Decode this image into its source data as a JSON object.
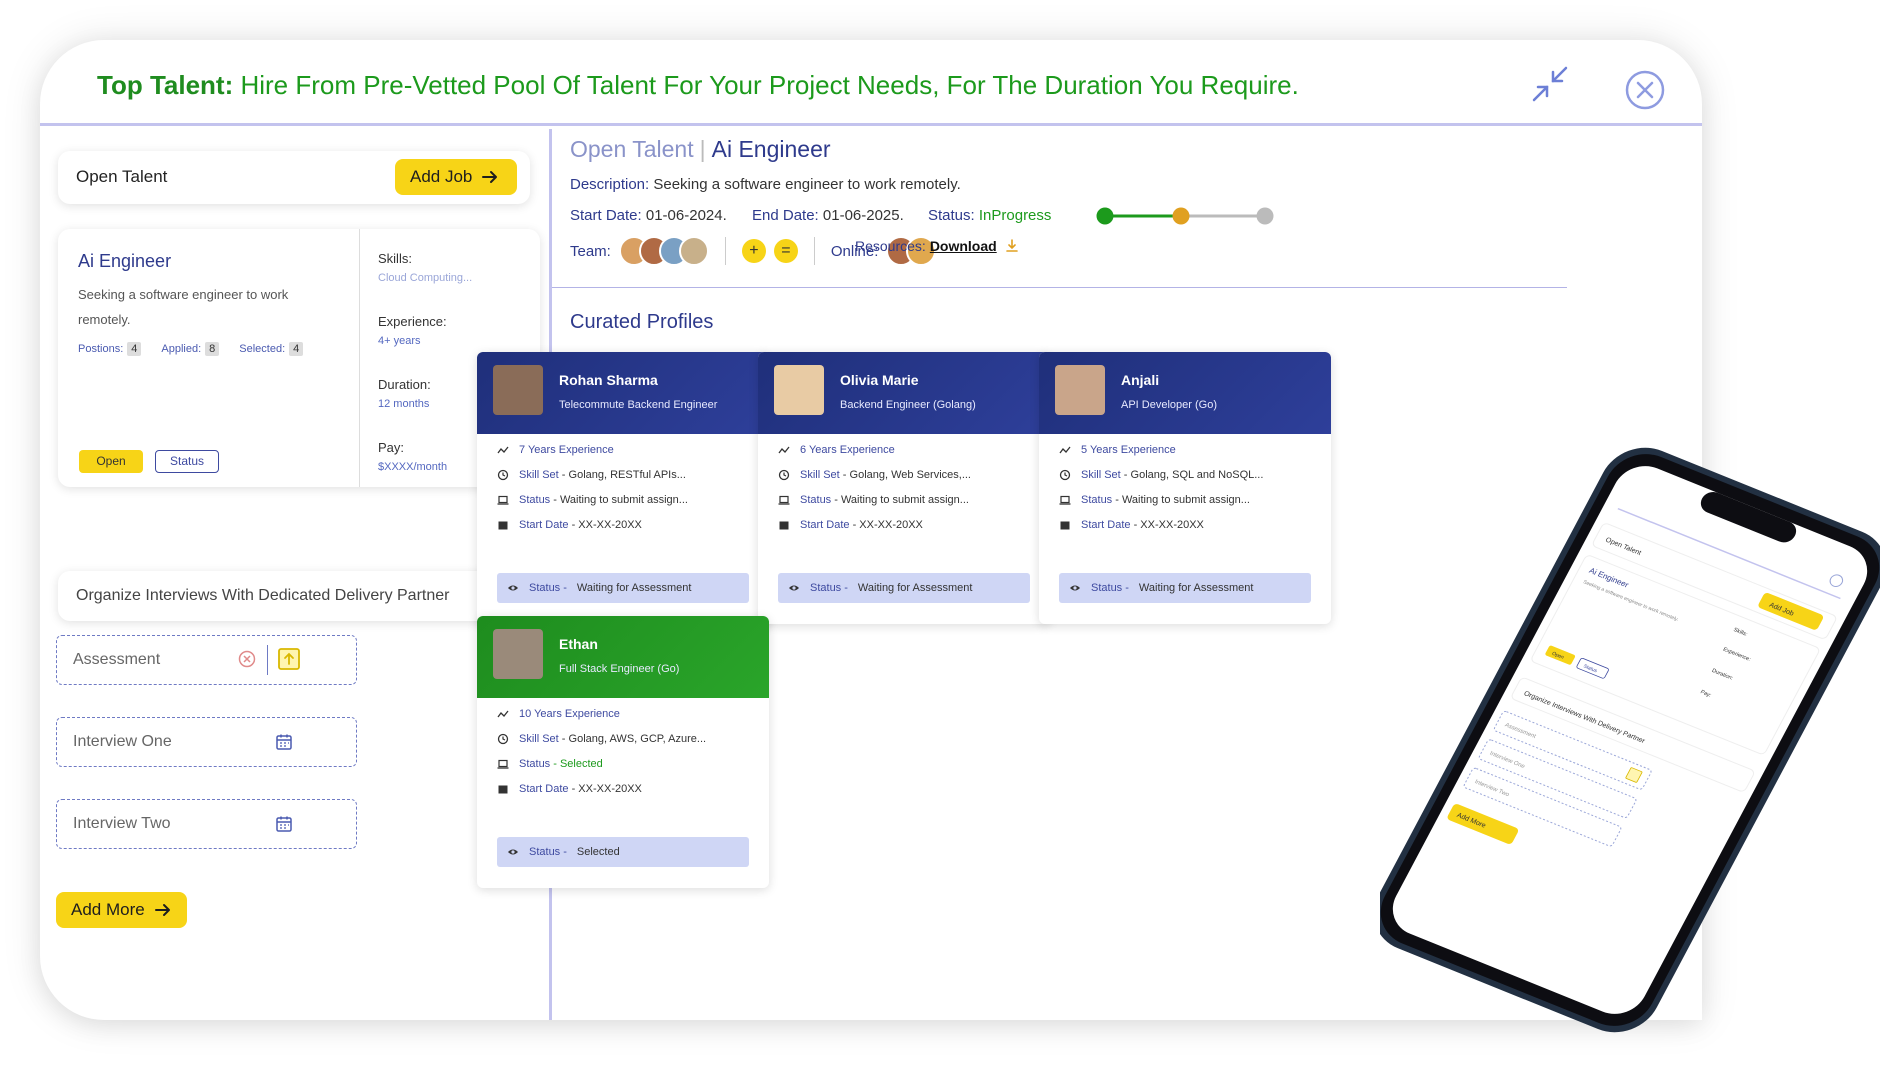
{
  "header": {
    "title_bold": "Top Talent:",
    "title_rest": " Hire From Pre-Vetted Pool Of Talent For Your Project Needs, For The Duration You Require."
  },
  "left": {
    "open_talent_label": "Open Talent",
    "add_job_label": "Add Job",
    "job": {
      "title": "Ai Engineer",
      "description": "Seeking a software engineer to work remotely.",
      "positions_label": "Postions:",
      "positions": "4",
      "applied_label": "Applied:",
      "applied": "8",
      "selected_label": "Selected:",
      "selected": "4",
      "tag_open": "Open",
      "tag_status": "Status",
      "skills_label": "Skills:",
      "skills": "Cloud Computing...",
      "experience_label": "Experience:",
      "experience": "4+ years",
      "duration_label": "Duration:",
      "duration": "12 months",
      "pay_label": "Pay:",
      "pay": "$XXXX/month"
    },
    "organize_label": "Organize Interviews With Dedicated Delivery Partner",
    "fields": {
      "assessment": "Assessment",
      "interview_one": "Interview One",
      "interview_two": "Interview Two"
    },
    "add_more_label": "Add More"
  },
  "right": {
    "breadcrumb_root": "Open Talent",
    "breadcrumb_sep": "|",
    "breadcrumb_current": "Ai Engineer",
    "description_label": "Description:",
    "description": " Seeking a software engineer to work remotely.",
    "start_label": "Start Date:",
    "start": " 01-06-2024.",
    "end_label": "End Date:",
    "end": " 01-06-2025.",
    "status_label": "Status:",
    "status": " InProgress",
    "team_label": "Team:",
    "online_label": "Online:",
    "resources_label": "Resources:",
    "download_label": "Download",
    "curated_title": "Curated Profiles",
    "progress_color_done": "#1c9a1c",
    "progress_color_current": "#e0a020",
    "progress_color_pending": "#bbbbbb"
  },
  "profiles": [
    {
      "name": "Rohan Sharma",
      "role": "Telecommute Backend Engineer",
      "experience": "7 Years Experience",
      "skill_label": "Skill Set",
      "skill": " - Golang, RESTful APIs...",
      "status_label": "Status",
      "status": " - Waiting to submit assign...",
      "start_label": "Start Date",
      "start": " - XX-XX-20XX",
      "box_label": "Status -",
      "box_value": "Waiting for Assessment"
    },
    {
      "name": "Olivia Marie",
      "role": "Backend Engineer (Golang)",
      "experience": "6 Years Experience",
      "skill_label": "Skill Set",
      "skill": " - Golang, Web Services,...",
      "status_label": "Status",
      "status": " - Waiting to submit assign...",
      "start_label": "Start Date",
      "start": " - XX-XX-20XX",
      "box_label": "Status -",
      "box_value": "Waiting for Assessment"
    },
    {
      "name": "Anjali",
      "role": "API Developer (Go)",
      "experience": "5 Years Experience",
      "skill_label": "Skill Set",
      "skill": " - Golang, SQL and NoSQL...",
      "status_label": "Status",
      "status": " - Waiting to submit assign...",
      "start_label": "Start Date",
      "start": " - XX-XX-20XX",
      "box_label": "Status -",
      "box_value": "Waiting for Assessment"
    },
    {
      "name": "Ethan",
      "role": "Full Stack Engineer (Go)",
      "experience": "10 Years Experience",
      "skill_label": "Skill Set",
      "skill": " - Golang, AWS, GCP, Azure...",
      "status_label": "Status",
      "status": " - Selected",
      "start_label": "Start Date",
      "start": " - XX-XX-20XX",
      "box_label": "Status -",
      "box_value": "Selected"
    }
  ],
  "phone": {
    "open_talent": "Open Talent",
    "add_job": "Add Job",
    "job_title": "Ai Engineer",
    "job_desc": "Seeking a software engineer to work remotely.",
    "skills": "Skills:",
    "experience": "Experience:",
    "duration": "Duration:",
    "pay": "Pay:",
    "open": "Open",
    "status": "Status",
    "organize": "Organize Interviews With Delivery Partner",
    "assessment": "Assessment",
    "interview_one": "Interview One",
    "interview_two": "Interview Two",
    "add_more": "Add More"
  },
  "colors": {
    "brand_green": "#1c9a1c",
    "brand_navy": "#2e3a8c",
    "accent_yellow": "#f7d417"
  }
}
